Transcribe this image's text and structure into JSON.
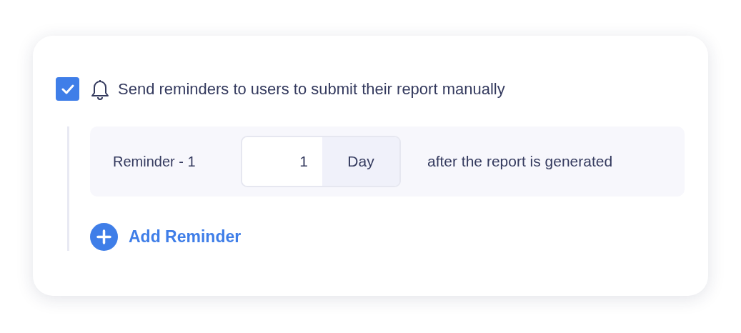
{
  "reminders_toggle": {
    "checked": true,
    "label": "Send reminders to users to submit their report manually"
  },
  "reminders": [
    {
      "label": "Reminder - 1",
      "value": "1",
      "unit": "Day",
      "suffix": "after the report is generated"
    }
  ],
  "add_button": {
    "label": "Add Reminder"
  }
}
